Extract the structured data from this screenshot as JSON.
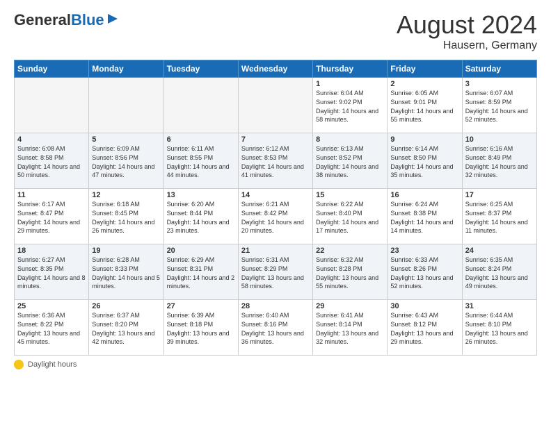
{
  "header": {
    "logo_general": "General",
    "logo_blue": "Blue",
    "month_title": "August 2024",
    "location": "Hausern, Germany"
  },
  "days_of_week": [
    "Sunday",
    "Monday",
    "Tuesday",
    "Wednesday",
    "Thursday",
    "Friday",
    "Saturday"
  ],
  "weeks": [
    [
      {
        "day": "",
        "sunrise": "",
        "sunset": "",
        "daylight": "",
        "empty": true
      },
      {
        "day": "",
        "sunrise": "",
        "sunset": "",
        "daylight": "",
        "empty": true
      },
      {
        "day": "",
        "sunrise": "",
        "sunset": "",
        "daylight": "",
        "empty": true
      },
      {
        "day": "",
        "sunrise": "",
        "sunset": "",
        "daylight": "",
        "empty": true
      },
      {
        "day": "1",
        "sunrise": "Sunrise: 6:04 AM",
        "sunset": "Sunset: 9:02 PM",
        "daylight": "Daylight: 14 hours and 58 minutes.",
        "empty": false
      },
      {
        "day": "2",
        "sunrise": "Sunrise: 6:05 AM",
        "sunset": "Sunset: 9:01 PM",
        "daylight": "Daylight: 14 hours and 55 minutes.",
        "empty": false
      },
      {
        "day": "3",
        "sunrise": "Sunrise: 6:07 AM",
        "sunset": "Sunset: 8:59 PM",
        "daylight": "Daylight: 14 hours and 52 minutes.",
        "empty": false
      }
    ],
    [
      {
        "day": "4",
        "sunrise": "Sunrise: 6:08 AM",
        "sunset": "Sunset: 8:58 PM",
        "daylight": "Daylight: 14 hours and 50 minutes.",
        "empty": false
      },
      {
        "day": "5",
        "sunrise": "Sunrise: 6:09 AM",
        "sunset": "Sunset: 8:56 PM",
        "daylight": "Daylight: 14 hours and 47 minutes.",
        "empty": false
      },
      {
        "day": "6",
        "sunrise": "Sunrise: 6:11 AM",
        "sunset": "Sunset: 8:55 PM",
        "daylight": "Daylight: 14 hours and 44 minutes.",
        "empty": false
      },
      {
        "day": "7",
        "sunrise": "Sunrise: 6:12 AM",
        "sunset": "Sunset: 8:53 PM",
        "daylight": "Daylight: 14 hours and 41 minutes.",
        "empty": false
      },
      {
        "day": "8",
        "sunrise": "Sunrise: 6:13 AM",
        "sunset": "Sunset: 8:52 PM",
        "daylight": "Daylight: 14 hours and 38 minutes.",
        "empty": false
      },
      {
        "day": "9",
        "sunrise": "Sunrise: 6:14 AM",
        "sunset": "Sunset: 8:50 PM",
        "daylight": "Daylight: 14 hours and 35 minutes.",
        "empty": false
      },
      {
        "day": "10",
        "sunrise": "Sunrise: 6:16 AM",
        "sunset": "Sunset: 8:49 PM",
        "daylight": "Daylight: 14 hours and 32 minutes.",
        "empty": false
      }
    ],
    [
      {
        "day": "11",
        "sunrise": "Sunrise: 6:17 AM",
        "sunset": "Sunset: 8:47 PM",
        "daylight": "Daylight: 14 hours and 29 minutes.",
        "empty": false
      },
      {
        "day": "12",
        "sunrise": "Sunrise: 6:18 AM",
        "sunset": "Sunset: 8:45 PM",
        "daylight": "Daylight: 14 hours and 26 minutes.",
        "empty": false
      },
      {
        "day": "13",
        "sunrise": "Sunrise: 6:20 AM",
        "sunset": "Sunset: 8:44 PM",
        "daylight": "Daylight: 14 hours and 23 minutes.",
        "empty": false
      },
      {
        "day": "14",
        "sunrise": "Sunrise: 6:21 AM",
        "sunset": "Sunset: 8:42 PM",
        "daylight": "Daylight: 14 hours and 20 minutes.",
        "empty": false
      },
      {
        "day": "15",
        "sunrise": "Sunrise: 6:22 AM",
        "sunset": "Sunset: 8:40 PM",
        "daylight": "Daylight: 14 hours and 17 minutes.",
        "empty": false
      },
      {
        "day": "16",
        "sunrise": "Sunrise: 6:24 AM",
        "sunset": "Sunset: 8:38 PM",
        "daylight": "Daylight: 14 hours and 14 minutes.",
        "empty": false
      },
      {
        "day": "17",
        "sunrise": "Sunrise: 6:25 AM",
        "sunset": "Sunset: 8:37 PM",
        "daylight": "Daylight: 14 hours and 11 minutes.",
        "empty": false
      }
    ],
    [
      {
        "day": "18",
        "sunrise": "Sunrise: 6:27 AM",
        "sunset": "Sunset: 8:35 PM",
        "daylight": "Daylight: 14 hours and 8 minutes.",
        "empty": false
      },
      {
        "day": "19",
        "sunrise": "Sunrise: 6:28 AM",
        "sunset": "Sunset: 8:33 PM",
        "daylight": "Daylight: 14 hours and 5 minutes.",
        "empty": false
      },
      {
        "day": "20",
        "sunrise": "Sunrise: 6:29 AM",
        "sunset": "Sunset: 8:31 PM",
        "daylight": "Daylight: 14 hours and 2 minutes.",
        "empty": false
      },
      {
        "day": "21",
        "sunrise": "Sunrise: 6:31 AM",
        "sunset": "Sunset: 8:29 PM",
        "daylight": "Daylight: 13 hours and 58 minutes.",
        "empty": false
      },
      {
        "day": "22",
        "sunrise": "Sunrise: 6:32 AM",
        "sunset": "Sunset: 8:28 PM",
        "daylight": "Daylight: 13 hours and 55 minutes.",
        "empty": false
      },
      {
        "day": "23",
        "sunrise": "Sunrise: 6:33 AM",
        "sunset": "Sunset: 8:26 PM",
        "daylight": "Daylight: 13 hours and 52 minutes.",
        "empty": false
      },
      {
        "day": "24",
        "sunrise": "Sunrise: 6:35 AM",
        "sunset": "Sunset: 8:24 PM",
        "daylight": "Daylight: 13 hours and 49 minutes.",
        "empty": false
      }
    ],
    [
      {
        "day": "25",
        "sunrise": "Sunrise: 6:36 AM",
        "sunset": "Sunset: 8:22 PM",
        "daylight": "Daylight: 13 hours and 45 minutes.",
        "empty": false
      },
      {
        "day": "26",
        "sunrise": "Sunrise: 6:37 AM",
        "sunset": "Sunset: 8:20 PM",
        "daylight": "Daylight: 13 hours and 42 minutes.",
        "empty": false
      },
      {
        "day": "27",
        "sunrise": "Sunrise: 6:39 AM",
        "sunset": "Sunset: 8:18 PM",
        "daylight": "Daylight: 13 hours and 39 minutes.",
        "empty": false
      },
      {
        "day": "28",
        "sunrise": "Sunrise: 6:40 AM",
        "sunset": "Sunset: 8:16 PM",
        "daylight": "Daylight: 13 hours and 36 minutes.",
        "empty": false
      },
      {
        "day": "29",
        "sunrise": "Sunrise: 6:41 AM",
        "sunset": "Sunset: 8:14 PM",
        "daylight": "Daylight: 13 hours and 32 minutes.",
        "empty": false
      },
      {
        "day": "30",
        "sunrise": "Sunrise: 6:43 AM",
        "sunset": "Sunset: 8:12 PM",
        "daylight": "Daylight: 13 hours and 29 minutes.",
        "empty": false
      },
      {
        "day": "31",
        "sunrise": "Sunrise: 6:44 AM",
        "sunset": "Sunset: 8:10 PM",
        "daylight": "Daylight: 13 hours and 26 minutes.",
        "empty": false
      }
    ]
  ],
  "footer": {
    "daylight_label": "Daylight hours"
  }
}
